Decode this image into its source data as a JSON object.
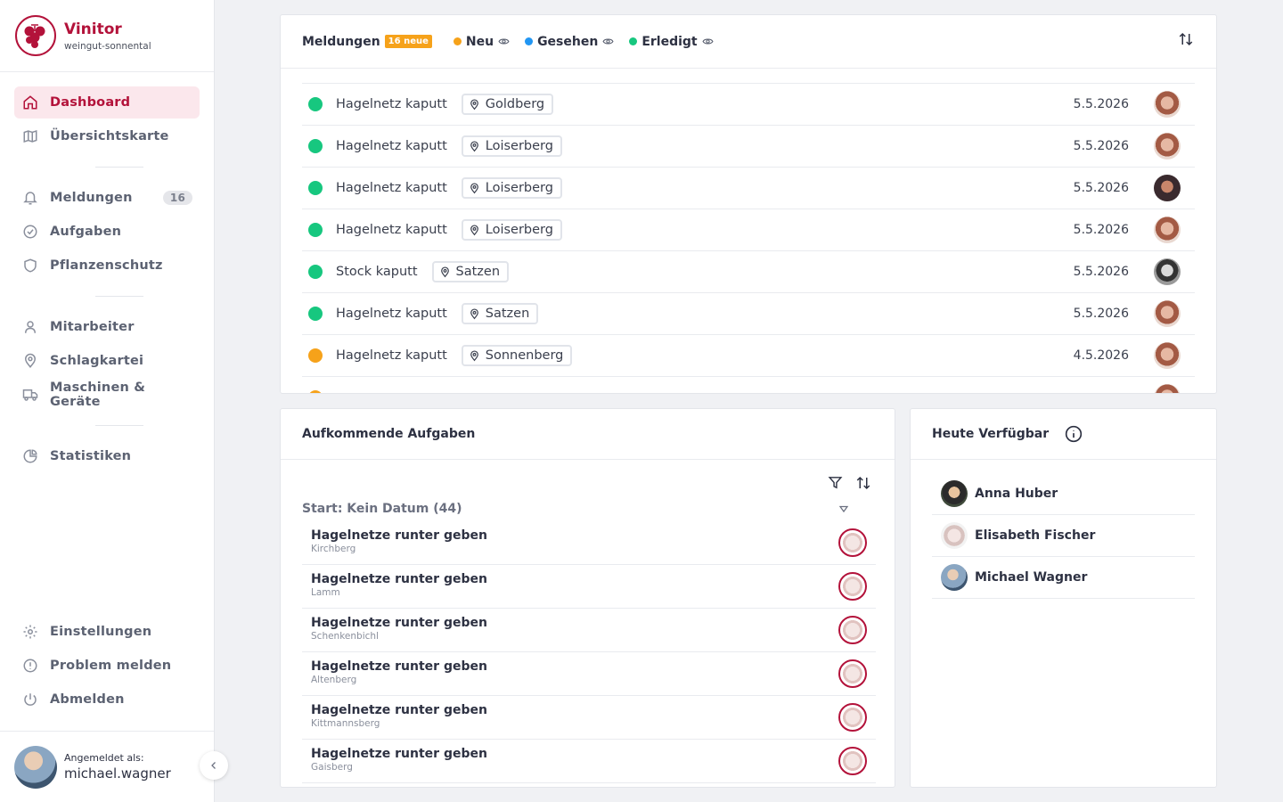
{
  "brand": {
    "name": "Vinitor",
    "subtitle": "weingut-sonnental",
    "color": "#b3123a"
  },
  "sidebar": {
    "items": [
      {
        "label": "Dashboard",
        "icon": "home-icon",
        "active": true
      },
      {
        "label": "Übersichtskarte",
        "icon": "map-icon"
      },
      {
        "label": "Meldungen",
        "icon": "bell-icon",
        "badge": "16"
      },
      {
        "label": "Aufgaben",
        "icon": "check-circle-icon"
      },
      {
        "label": "Pflanzenschutz",
        "icon": "shield-icon"
      },
      {
        "label": "Mitarbeiter",
        "icon": "user-icon"
      },
      {
        "label": "Schlagkartei",
        "icon": "map-pin-icon"
      },
      {
        "label": "Maschinen & Geräte",
        "icon": "truck-icon"
      },
      {
        "label": "Statistiken",
        "icon": "pie-chart-icon"
      },
      {
        "label": "Einstellungen",
        "icon": "gear-icon"
      },
      {
        "label": "Problem melden",
        "icon": "alert-circle-icon"
      },
      {
        "label": "Abmelden",
        "icon": "power-icon"
      }
    ],
    "user": {
      "caption": "Angemeldet als:",
      "name": "michael.wagner"
    }
  },
  "meldungen": {
    "title": "Meldungen",
    "new_badge": "16 neue",
    "legend": [
      {
        "label": "Neu",
        "color": "#f6a21a"
      },
      {
        "label": "Gesehen",
        "color": "#2196f3"
      },
      {
        "label": "Erledigt",
        "color": "#17c77f"
      }
    ],
    "rows": [
      {
        "status": "Erledigt",
        "title": "Hagelnetz kaputt",
        "location": "Goldberg",
        "date": "5.5.2026"
      },
      {
        "status": "Erledigt",
        "title": "Hagelnetz kaputt",
        "location": "Loiserberg",
        "date": "5.5.2026"
      },
      {
        "status": "Erledigt",
        "title": "Hagelnetz kaputt",
        "location": "Loiserberg",
        "date": "5.5.2026"
      },
      {
        "status": "Erledigt",
        "title": "Hagelnetz kaputt",
        "location": "Loiserberg",
        "date": "5.5.2026"
      },
      {
        "status": "Erledigt",
        "title": "Stock kaputt",
        "location": "Satzen",
        "date": "5.5.2026"
      },
      {
        "status": "Erledigt",
        "title": "Hagelnetz kaputt",
        "location": "Satzen",
        "date": "5.5.2026"
      },
      {
        "status": "Neu",
        "title": "Hagelnetz kaputt",
        "location": "Sonnenberg",
        "date": "4.5.2026"
      }
    ]
  },
  "aufgaben": {
    "title": "Aufkommende Aufgaben",
    "group_label": "Start: Kein Datum (44)",
    "rows": [
      {
        "title": "Hagelnetze runter geben",
        "location": "Kirchberg"
      },
      {
        "title": "Hagelnetze runter geben",
        "location": "Lamm"
      },
      {
        "title": "Hagelnetze runter geben",
        "location": "Schenkenbichl"
      },
      {
        "title": "Hagelnetze runter geben",
        "location": "Altenberg"
      },
      {
        "title": "Hagelnetze runter geben",
        "location": "Kittmannsberg"
      },
      {
        "title": "Hagelnetze runter geben",
        "location": "Gaisberg"
      }
    ]
  },
  "verfuegbar": {
    "title": "Heute Verfügbar",
    "people": [
      {
        "name": "Anna Huber"
      },
      {
        "name": "Elisabeth Fischer"
      },
      {
        "name": "Michael Wagner"
      }
    ]
  }
}
